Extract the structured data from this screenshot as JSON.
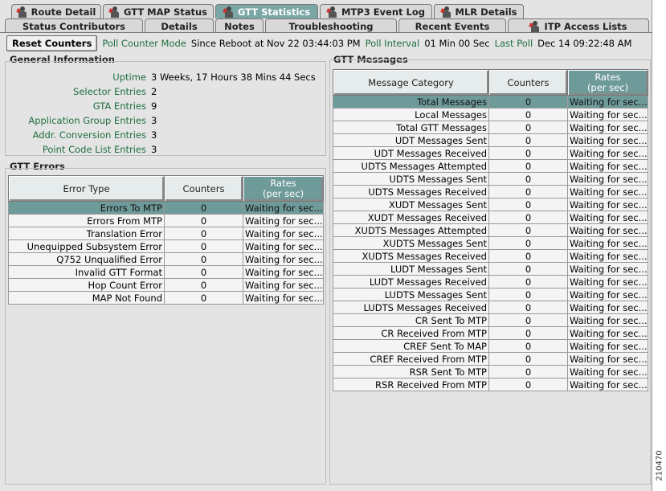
{
  "tabs_top": [
    {
      "label": "Route Detail",
      "icon": "person-icon"
    },
    {
      "label": "GTT MAP Status",
      "icon": "person-icon"
    },
    {
      "label": "GTT Statistics",
      "icon": "person-icon",
      "active": true
    },
    {
      "label": "MTP3 Event Log",
      "icon": "person-icon"
    },
    {
      "label": "MLR Details",
      "icon": "person-icon"
    }
  ],
  "tabs_bottom": [
    {
      "label": "Status Contributors"
    },
    {
      "label": "Details"
    },
    {
      "label": "Notes"
    },
    {
      "label": "Troubleshooting"
    },
    {
      "label": "Recent Events"
    },
    {
      "label": "ITP Access Lists",
      "icon": "person-icon"
    }
  ],
  "toolbar": {
    "reset_label": "Reset Counters",
    "poll_mode_label": "Poll Counter Mode",
    "poll_mode_value": "Since Reboot at Nov 22  03:44:03 PM",
    "poll_interval_label": "Poll Interval",
    "poll_interval_value": "01 Min 00 Sec",
    "last_poll_label": "Last Poll",
    "last_poll_value": "Dec 14  09:22:48 AM"
  },
  "general": {
    "title": "General Information",
    "rows": [
      {
        "k": "Uptime",
        "v": "3 Weeks, 17 Hours 38 Mins 44 Secs"
      },
      {
        "k": "Selector Entries",
        "v": "2"
      },
      {
        "k": "GTA Entries",
        "v": "9"
      },
      {
        "k": "Application Group Entries",
        "v": "3"
      },
      {
        "k": "Addr. Conversion Entries",
        "v": "3"
      },
      {
        "k": "Point Code List Entries",
        "v": "3"
      }
    ]
  },
  "errors": {
    "title": "GTT Errors",
    "headers": [
      "Error Type",
      "Counters",
      "Rates\n(per sec)"
    ],
    "rows": [
      [
        "Errors To MTP",
        "0",
        "Waiting for sec..."
      ],
      [
        "Errors From MTP",
        "0",
        "Waiting for sec..."
      ],
      [
        "Translation Error",
        "0",
        "Waiting for sec..."
      ],
      [
        "Unequipped Subsystem Error",
        "0",
        "Waiting for sec..."
      ],
      [
        "Q752 Unqualified Error",
        "0",
        "Waiting for sec..."
      ],
      [
        "Invalid GTT Format",
        "0",
        "Waiting for sec..."
      ],
      [
        "Hop Count Error",
        "0",
        "Waiting for sec..."
      ],
      [
        "MAP Not Found",
        "0",
        "Waiting for sec..."
      ]
    ]
  },
  "messages": {
    "title": "GTT Messages",
    "headers": [
      "Message Category",
      "Counters",
      "Rates\n(per sec)"
    ],
    "rows": [
      [
        "Total Messages",
        "0",
        "Waiting for sec..."
      ],
      [
        "Local Messages",
        "0",
        "Waiting for sec..."
      ],
      [
        "Total GTT Messages",
        "0",
        "Waiting for sec..."
      ],
      [
        "UDT Messages Sent",
        "0",
        "Waiting for sec..."
      ],
      [
        "UDT Messages Received",
        "0",
        "Waiting for sec..."
      ],
      [
        "UDTS Messages Attempted",
        "0",
        "Waiting for sec..."
      ],
      [
        "UDTS Messages Sent",
        "0",
        "Waiting for sec..."
      ],
      [
        "UDTS Messages Received",
        "0",
        "Waiting for sec..."
      ],
      [
        "XUDT Messages Sent",
        "0",
        "Waiting for sec..."
      ],
      [
        "XUDT Messages Received",
        "0",
        "Waiting for sec..."
      ],
      [
        "XUDTS Messages Attempted",
        "0",
        "Waiting for sec..."
      ],
      [
        "XUDTS Messages Sent",
        "0",
        "Waiting for sec..."
      ],
      [
        "XUDTS Messages Received",
        "0",
        "Waiting for sec..."
      ],
      [
        "LUDT Messages Sent",
        "0",
        "Waiting for sec..."
      ],
      [
        "LUDT Messages Received",
        "0",
        "Waiting for sec..."
      ],
      [
        "LUDTS Messages Sent",
        "0",
        "Waiting for sec..."
      ],
      [
        "LUDTS Messages Received",
        "0",
        "Waiting for sec..."
      ],
      [
        "CR Sent To MTP",
        "0",
        "Waiting for sec..."
      ],
      [
        "CR Received From MTP",
        "0",
        "Waiting for sec..."
      ],
      [
        "CREF Sent To MAP",
        "0",
        "Waiting for sec..."
      ],
      [
        "CREF Received From MTP",
        "0",
        "Waiting for sec..."
      ],
      [
        "RSR Sent To MTP",
        "0",
        "Waiting for sec..."
      ],
      [
        "RSR Received From MTP",
        "0",
        "Waiting for sec..."
      ]
    ]
  },
  "figure_id": "210470"
}
